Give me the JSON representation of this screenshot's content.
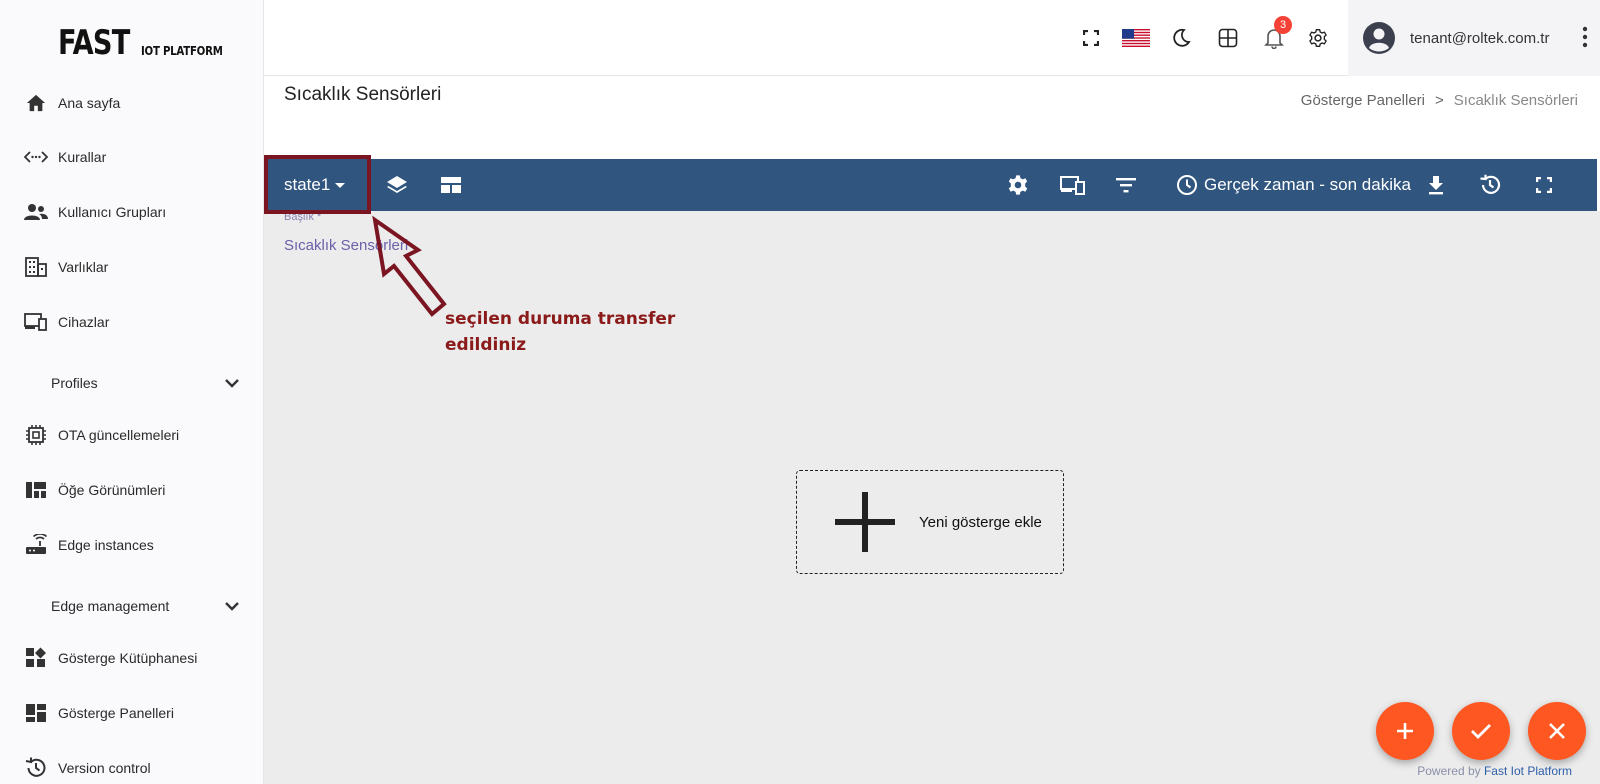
{
  "logo": {
    "main": "FAST",
    "sub": "IOT PLATFORM"
  },
  "sidebar": {
    "items": [
      {
        "label": "Ana sayfa",
        "icon": "home-icon"
      },
      {
        "label": "Kurallar",
        "icon": "rule-chain-icon"
      },
      {
        "label": "Kullanıcı Grupları",
        "icon": "people-icon"
      },
      {
        "label": "Varlıklar",
        "icon": "building-icon"
      },
      {
        "label": "Cihazlar",
        "icon": "devices-icon"
      },
      {
        "label": "Profiles",
        "icon": "chevron-down-icon"
      },
      {
        "label": "OTA güncellemeleri",
        "icon": "chip-icon"
      },
      {
        "label": "Öğe Görünümleri",
        "icon": "view-quilt-icon"
      },
      {
        "label": "Edge instances",
        "icon": "router-icon"
      },
      {
        "label": "Edge management",
        "icon": "chevron-down-icon"
      },
      {
        "label": "Gösterge Kütüphanesi",
        "icon": "widgets-icon"
      },
      {
        "label": "Gösterge Panelleri",
        "icon": "dashboard-icon"
      },
      {
        "label": "Version control",
        "icon": "history-icon"
      }
    ]
  },
  "header": {
    "notification_count": "3",
    "user_email": "tenant@roltek.com.tr"
  },
  "page": {
    "title": "Sıcaklık Sensörleri",
    "breadcrumb": {
      "parent": "Gösterge Panelleri",
      "separator": ">",
      "current": "Sıcaklık Sensörleri"
    }
  },
  "toolbar": {
    "state": "state1",
    "timewindow": "Gerçek zaman - son dakika"
  },
  "canvas": {
    "title_field_label": "Başlık *",
    "title_field_value": "Sıcaklık Sensörleri",
    "add_widget_label": "Yeni gösterge ekle"
  },
  "annotation": {
    "text": "seçilen duruma transfer edildiniz",
    "color": "#8b1a1a"
  },
  "footer": {
    "powered_prefix": "Powered by",
    "powered_brand": "Fast Iot Platform"
  },
  "colors": {
    "toolbar": "#305680",
    "fab": "#ff5722",
    "highlight": "#7a1521"
  }
}
